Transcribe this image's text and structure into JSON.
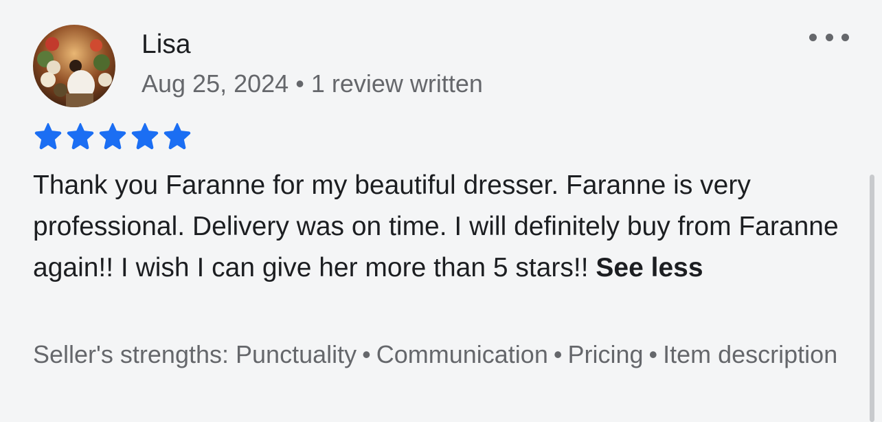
{
  "review": {
    "reviewer_name": "Lisa",
    "date": "Aug 25, 2024",
    "separator": "•",
    "review_count": "1 review written",
    "rating": 5,
    "rating_max": 5,
    "text": "Thank you Faranne for my beautiful dresser. Faranne is very professional. Delivery was on time. I will definitely buy from Faranne again!! I wish I can give her more than 5 stars!!",
    "see_less_label": "See less",
    "strengths_label": "Seller's strengths:",
    "strengths": [
      "Punctuality",
      "Communication",
      "Pricing",
      "Item description"
    ]
  },
  "icons": {
    "more": "more-horizontal-icon",
    "star": "star-icon"
  },
  "colors": {
    "star": "#1b6ef3",
    "background": "#f4f5f6",
    "secondary_text": "#65676b",
    "primary_text": "#1c1e21"
  }
}
